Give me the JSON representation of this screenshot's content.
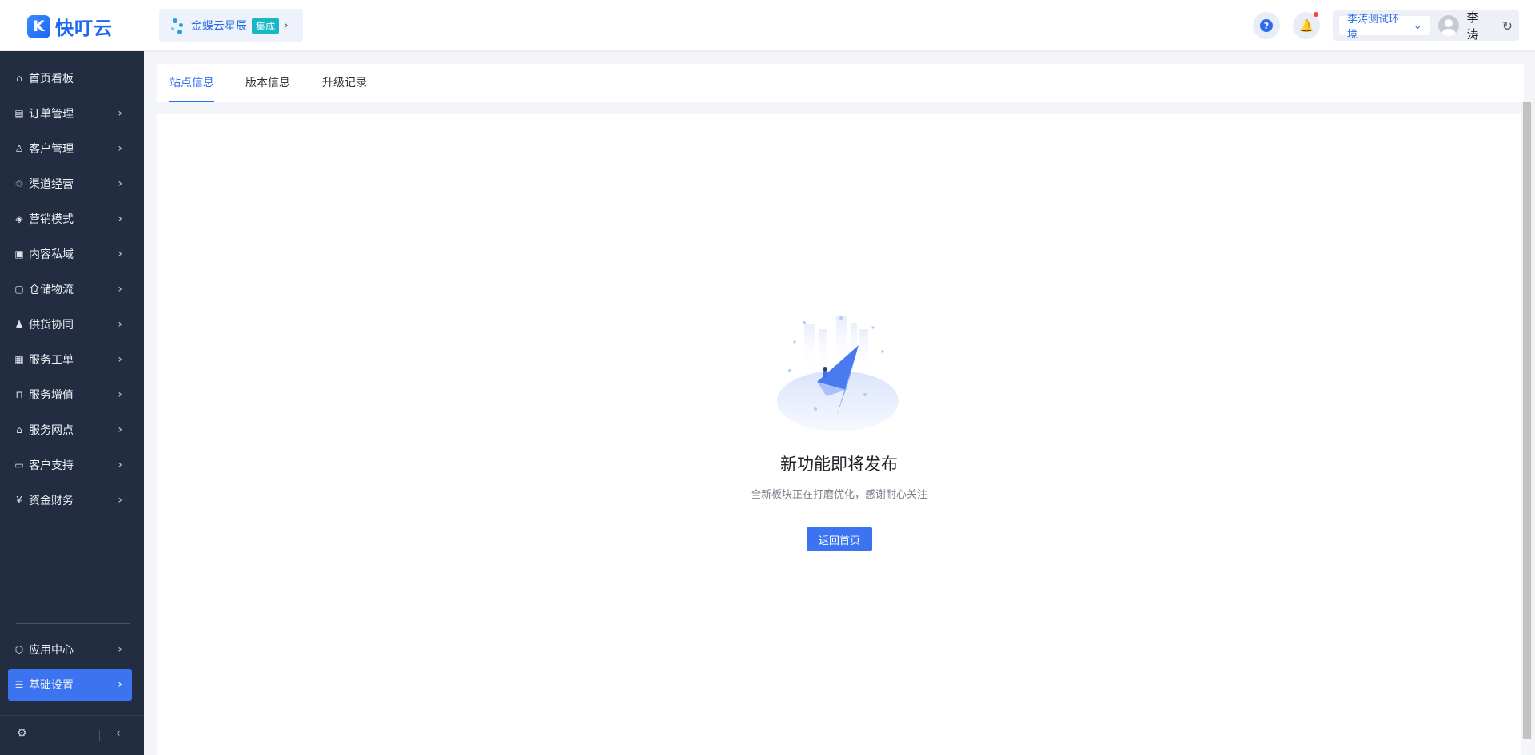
{
  "brand": {
    "logo_glyph": "K",
    "name": "快叮云",
    "color": "#1a66f5"
  },
  "integration": {
    "name": "金蝶云星辰",
    "badge": "集成",
    "chevron": "›"
  },
  "header": {
    "help_glyph": "?",
    "bell_glyph": "🔔",
    "env": "李涛测试环境",
    "env_chevron": "⌄",
    "user_name": "李涛",
    "refresh_glyph": "↻"
  },
  "sidebar": {
    "items": [
      {
        "label": "首页看板",
        "icon": "home-icon",
        "glyph": "⌂",
        "has_arrow": false
      },
      {
        "label": "订单管理",
        "icon": "order-icon",
        "glyph": "▤",
        "has_arrow": true
      },
      {
        "label": "客户管理",
        "icon": "customer-icon",
        "glyph": "♙",
        "has_arrow": true
      },
      {
        "label": "渠道经营",
        "icon": "channel-icon",
        "glyph": "♲",
        "has_arrow": true
      },
      {
        "label": "营销模式",
        "icon": "tag-icon",
        "glyph": "◈",
        "has_arrow": true
      },
      {
        "label": "内容私域",
        "icon": "image-icon",
        "glyph": "▣",
        "has_arrow": true
      },
      {
        "label": "仓储物流",
        "icon": "warehouse-icon",
        "glyph": "▢",
        "has_arrow": true
      },
      {
        "label": "供货协同",
        "icon": "supply-icon",
        "glyph": "♟",
        "has_arrow": true
      },
      {
        "label": "服务工单",
        "icon": "ticket-icon",
        "glyph": "▦",
        "has_arrow": true
      },
      {
        "label": "服务增值",
        "icon": "bag-icon",
        "glyph": "⊓",
        "has_arrow": true
      },
      {
        "label": "服务网点",
        "icon": "store-icon",
        "glyph": "⌂",
        "has_arrow": true
      },
      {
        "label": "客户支持",
        "icon": "support-icon",
        "glyph": "▭",
        "has_arrow": true
      },
      {
        "label": "资金财务",
        "icon": "yen-icon",
        "glyph": "¥",
        "has_arrow": true
      }
    ],
    "bottom_items": [
      {
        "label": "应用中心",
        "icon": "cube-icon",
        "glyph": "⬡",
        "has_arrow": true
      },
      {
        "label": "基础设置",
        "icon": "settings-sliders-icon",
        "glyph": "☰",
        "has_arrow": true
      }
    ],
    "arrow_glyph": "›",
    "footer": {
      "gear_glyph": "⚙",
      "collapse_glyph": "‹"
    }
  },
  "tabs": [
    {
      "label": "站点信息",
      "active": true
    },
    {
      "label": "版本信息",
      "active": false
    },
    {
      "label": "升级记录",
      "active": false
    }
  ],
  "empty_state": {
    "title": "新功能即将发布",
    "subtitle": "全新板块正在打磨优化，感谢耐心关注",
    "button": "返回首页"
  },
  "colors": {
    "sidebar_bg": "#232d42",
    "accent": "#3b73f0",
    "active_tab": "#2f6bf2"
  }
}
